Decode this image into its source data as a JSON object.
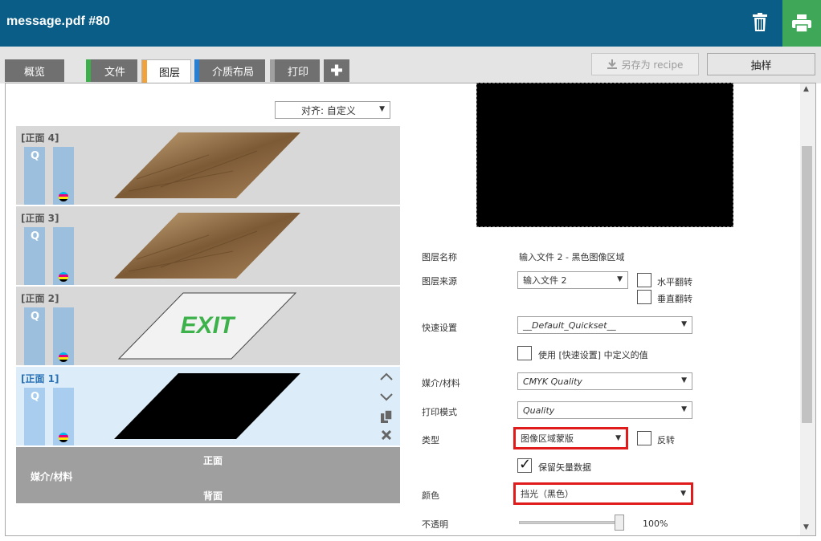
{
  "window": {
    "title": "message.pdf #80"
  },
  "tabs": [
    {
      "label": "概览",
      "stripe": ""
    },
    {
      "label": "文件",
      "stripe": "#3bb04a"
    },
    {
      "label": "图层",
      "stripe": "#f2a23a"
    },
    {
      "label": "介质布局",
      "stripe": "#2a7fd0"
    },
    {
      "label": "打印",
      "stripe": "#a0a0a0"
    }
  ],
  "toolbar": {
    "save_recipe": "另存为 recipe",
    "sample": "抽样"
  },
  "align": {
    "value": "对齐: 自定义"
  },
  "layers": [
    {
      "label": "[正面 4]",
      "q": "Q",
      "content": "wood"
    },
    {
      "label": "[正面 3]",
      "q": "Q",
      "content": "wood"
    },
    {
      "label": "[正面 2]",
      "q": "Q",
      "content": "EXIT"
    },
    {
      "label": "[正面 1]",
      "q": "Q",
      "content": "black"
    }
  ],
  "media_bar": {
    "front": "正面",
    "media": "媒介/材料",
    "back": "背面"
  },
  "properties": {
    "layer_name_label": "图层名称",
    "layer_name_value": "输入文件 2 - 黑色图像区域",
    "layer_source_label": "图层来源",
    "layer_source_value": "输入文件 2",
    "flip_h": "水平翻转",
    "flip_v": "垂直翻转",
    "quickset_label": "快速设置",
    "quickset_value": "__Default_Quickset__",
    "use_quickset": "使用 [快速设置] 中定义的值",
    "media_label": "媒介/材料",
    "media_value": "CMYK Quality",
    "print_mode_label": "打印模式",
    "print_mode_value": "Quality",
    "type_label": "类型",
    "type_value": "图像区域蒙版",
    "invert": "反转",
    "keep_vector": "保留矢量数据",
    "color_label": "颜色",
    "color_value": "挡光（黑色）",
    "opacity_label": "不透明",
    "opacity_value": "100%"
  },
  "colors": {
    "header": "#0a5d87",
    "print_button": "#3ea858",
    "highlight": "#e01b1b",
    "selected_layer": "#dcecf8"
  }
}
